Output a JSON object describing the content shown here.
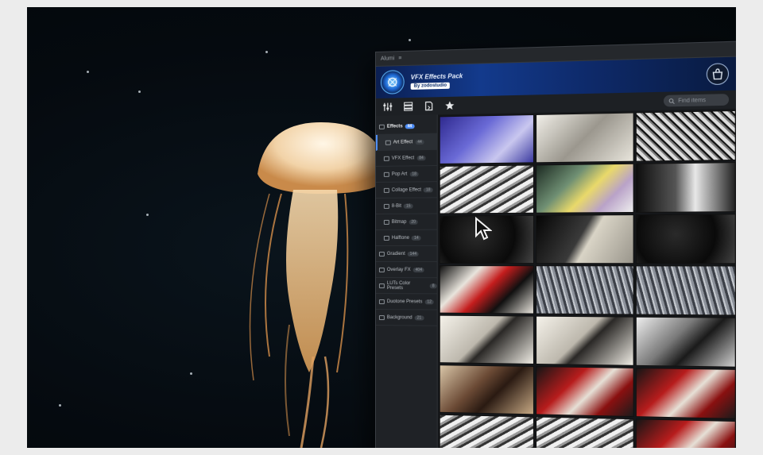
{
  "panel": {
    "window_title": "Alumi",
    "banner": {
      "title": "VFX Effects Pack",
      "by": "By zodostudio"
    },
    "search": {
      "placeholder": "Find items"
    },
    "toolbar_icons": [
      "sliders-icon",
      "layers-icon",
      "document-icon",
      "star-icon"
    ],
    "categories": [
      {
        "label": "Effects",
        "count": "44",
        "level": 0,
        "top": true
      },
      {
        "label": "Art Effect",
        "count": "44",
        "level": 1,
        "active": true
      },
      {
        "label": "VFX Effect",
        "count": "84",
        "level": 1
      },
      {
        "label": "Pop Art",
        "count": "18",
        "level": 1
      },
      {
        "label": "Collage Effect",
        "count": "18",
        "level": 1
      },
      {
        "label": "8-Bit",
        "count": "15",
        "level": 1
      },
      {
        "label": "Bitmap",
        "count": "20",
        "level": 1
      },
      {
        "label": "Halftone",
        "count": "14",
        "level": 1
      },
      {
        "label": "Gradient",
        "count": "144",
        "level": 0
      },
      {
        "label": "Overlay FX",
        "count": "404",
        "level": 0
      },
      {
        "label": "LUTs Color Presets",
        "count": "8",
        "level": 0
      },
      {
        "label": "Duotone Presets",
        "count": "12",
        "level": 0
      },
      {
        "label": "Background",
        "count": "21",
        "level": 0
      }
    ],
    "thumbnails": [
      {
        "style": "blue-duotone"
      },
      {
        "style": "sketch-light"
      },
      {
        "style": "sketch-grey"
      },
      {
        "style": "bw-texture"
      },
      {
        "style": "pastel-collage"
      },
      {
        "style": "bw-collage"
      },
      {
        "style": "dark-ink"
      },
      {
        "style": "ink-ornament"
      },
      {
        "style": "dark-ink"
      },
      {
        "style": "red-bw"
      },
      {
        "style": "grey-scratch"
      },
      {
        "style": "grey-scratch"
      },
      {
        "style": "pencil-light"
      },
      {
        "style": "pencil-light"
      },
      {
        "style": "charcoal"
      },
      {
        "style": "warm-photo"
      },
      {
        "style": "red-splash"
      },
      {
        "style": "red-splash"
      },
      {
        "style": "bw-texture"
      },
      {
        "style": "bw-texture"
      },
      {
        "style": "red-splash"
      }
    ],
    "footer_icons": [
      "compass-icon",
      "square-icon",
      "music-icon"
    ]
  },
  "colors": {
    "accent": "#4f8ff7",
    "banner": "#133a8c"
  }
}
